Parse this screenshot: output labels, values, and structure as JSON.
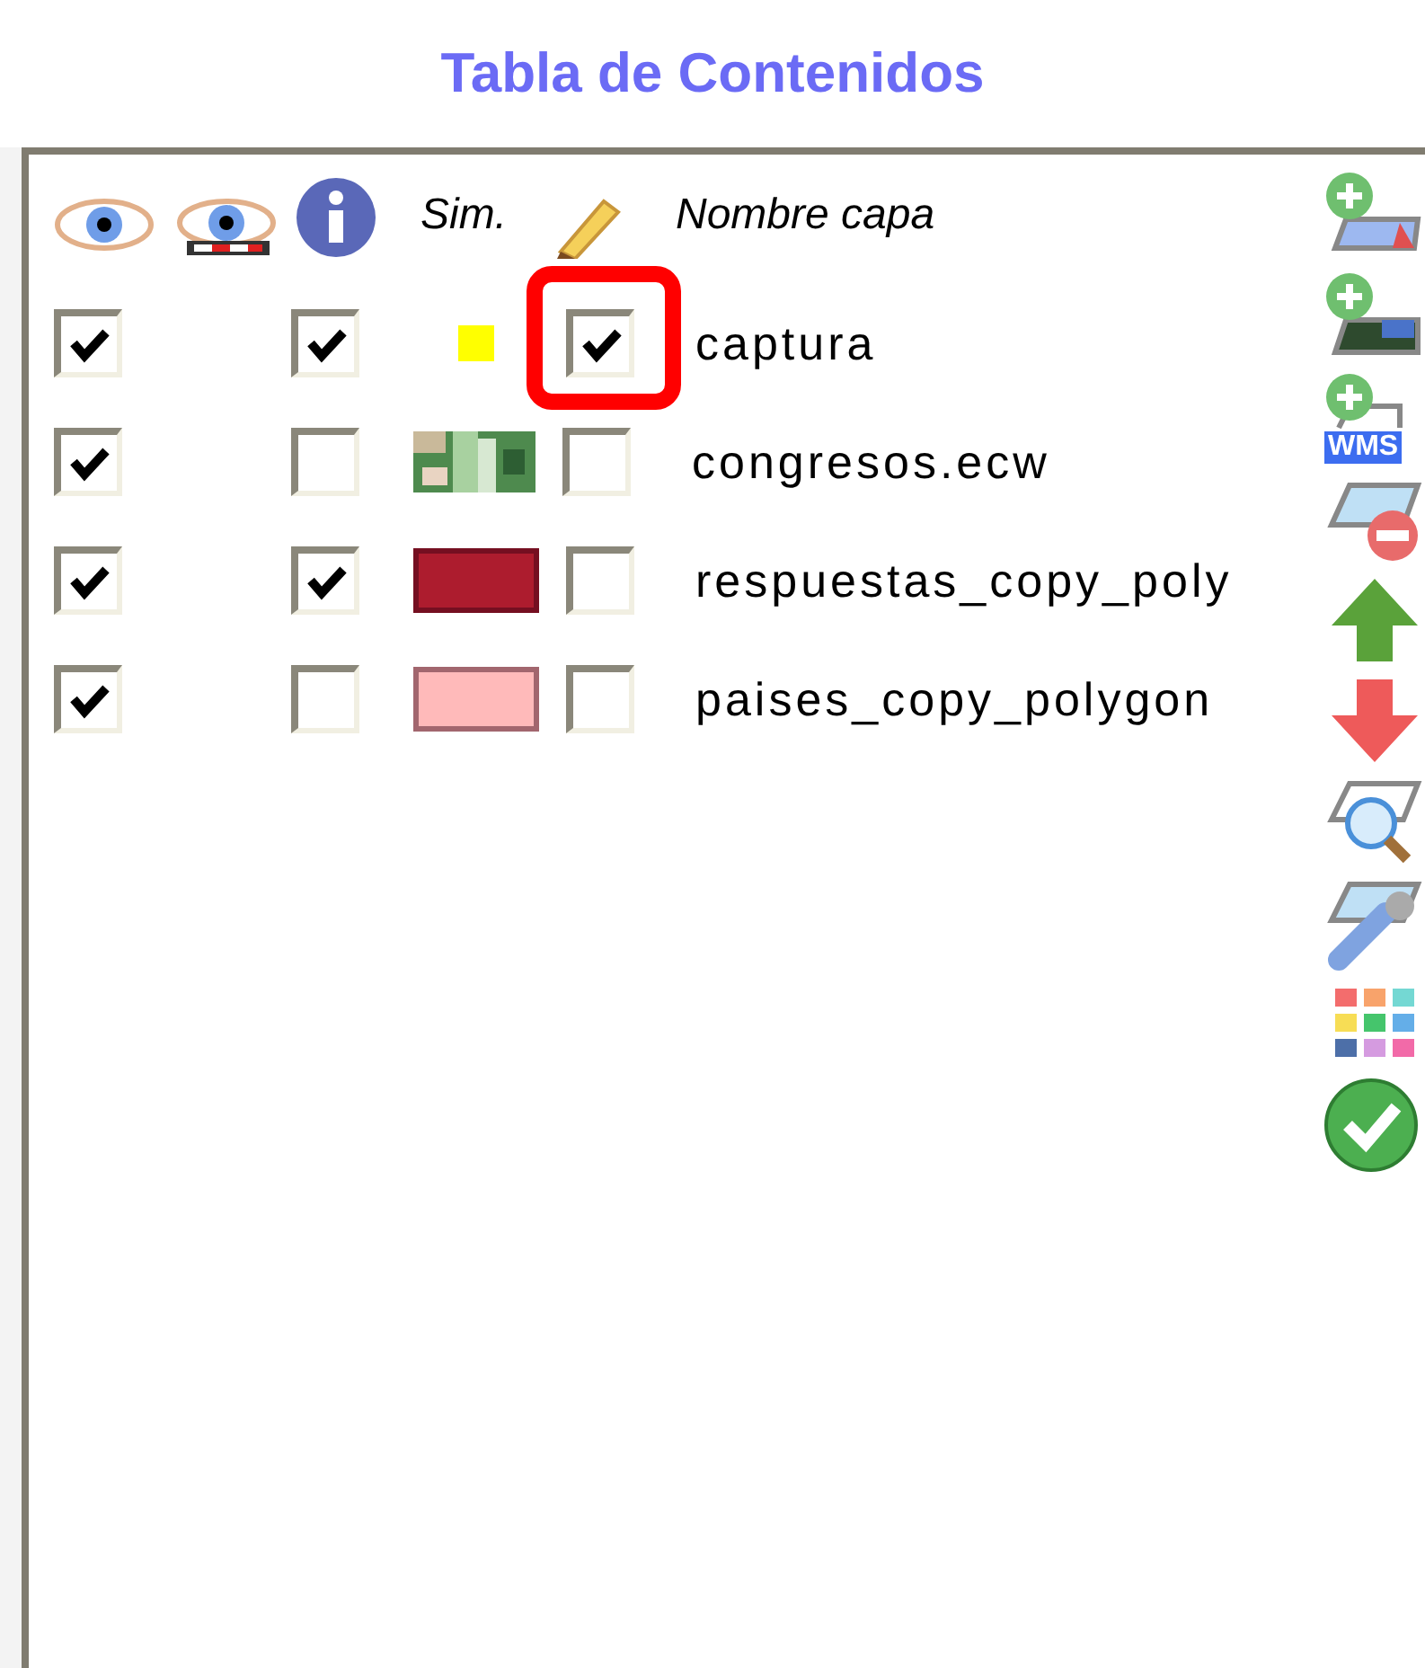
{
  "title": "Tabla de Contenidos",
  "columns": {
    "symbol": "Sim.",
    "name": "Nombre capa"
  },
  "layers": [
    {
      "visible": true,
      "queryable": true,
      "symbol": {
        "kind": "point",
        "color": "#ffff00"
      },
      "editable": true,
      "highlighted": true,
      "name": "captura"
    },
    {
      "visible": true,
      "queryable": false,
      "symbol": {
        "kind": "raster"
      },
      "editable": false,
      "highlighted": false,
      "name": "congresos.ecw"
    },
    {
      "visible": true,
      "queryable": true,
      "symbol": {
        "kind": "fill",
        "color": "#ad1c2e"
      },
      "editable": false,
      "highlighted": false,
      "name": "respuestas_copy_poly"
    },
    {
      "visible": true,
      "queryable": false,
      "symbol": {
        "kind": "fill",
        "color": "#ffbaba"
      },
      "editable": false,
      "highlighted": false,
      "name": "paises_copy_polygon"
    }
  ],
  "toolbar": [
    {
      "kind": "add-vector"
    },
    {
      "kind": "add-raster"
    },
    {
      "kind": "add-wms",
      "label": "WMS"
    },
    {
      "kind": "remove"
    },
    {
      "kind": "up"
    },
    {
      "kind": "down"
    },
    {
      "kind": "zoom"
    },
    {
      "kind": "properties"
    },
    {
      "kind": "palette"
    },
    {
      "kind": "accept"
    }
  ]
}
